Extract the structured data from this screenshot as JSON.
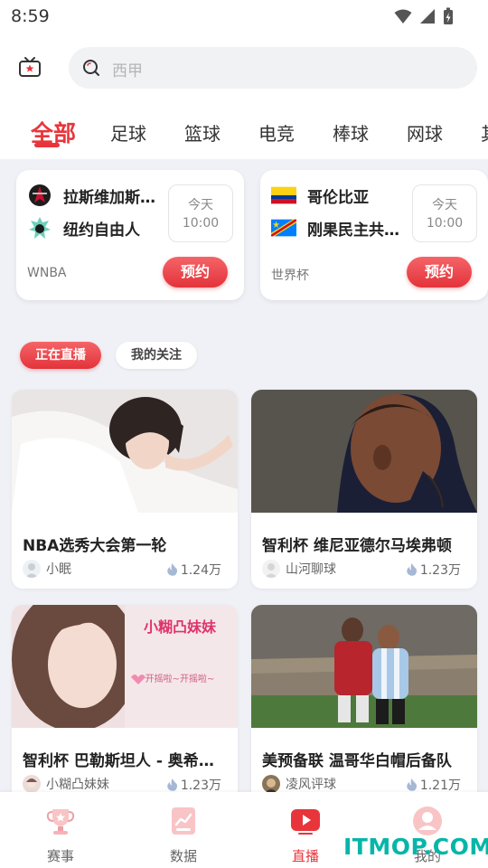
{
  "status_bar": {
    "time": "8:59"
  },
  "search": {
    "placeholder": "西甲"
  },
  "categories": [
    "全部",
    "足球",
    "篮球",
    "电竞",
    "棒球",
    "网球",
    "其"
  ],
  "matches": [
    {
      "home": "拉斯维加斯王牌",
      "away": "纽约自由人",
      "day": "今天",
      "time": "10:00",
      "league": "WNBA",
      "reserve_label": "预约"
    },
    {
      "home": "哥伦比亚",
      "away": "刚果民主共和国",
      "day": "今天",
      "time": "10:00",
      "league": "世界杯",
      "reserve_label": "预约"
    }
  ],
  "filters": {
    "live": "正在直播",
    "following": "我的关注"
  },
  "streams": [
    {
      "title": "NBA选秀大会第一轮",
      "streamer": "小眠",
      "views": "1.24万"
    },
    {
      "title": "智利杯  维尼亚德尔马埃弗顿",
      "streamer": "山河聊球",
      "views": "1.23万"
    },
    {
      "title": "智利杯   巴勒斯坦人 - 奥希金斯",
      "streamer": "小糊凸妹妹",
      "views": "1.23万",
      "thumb_text": "小糊凸妹妹",
      "thumb_subtext": "开摇啦~开摇啦~"
    },
    {
      "title": "美预备联 温哥华白帽后备队",
      "streamer": "凌风评球",
      "views": "1.21万"
    }
  ],
  "bottom_nav": [
    {
      "label": "赛事",
      "icon": "trophy-icon"
    },
    {
      "label": "数据",
      "icon": "chart-icon"
    },
    {
      "label": "直播",
      "icon": "play-icon"
    },
    {
      "label": "我的",
      "icon": "profile-icon"
    }
  ],
  "watermark": "ITMOP.COM",
  "colors": {
    "accent": "#e8353b",
    "watermark": "#06b6a8",
    "background": "#f0f1f6"
  }
}
